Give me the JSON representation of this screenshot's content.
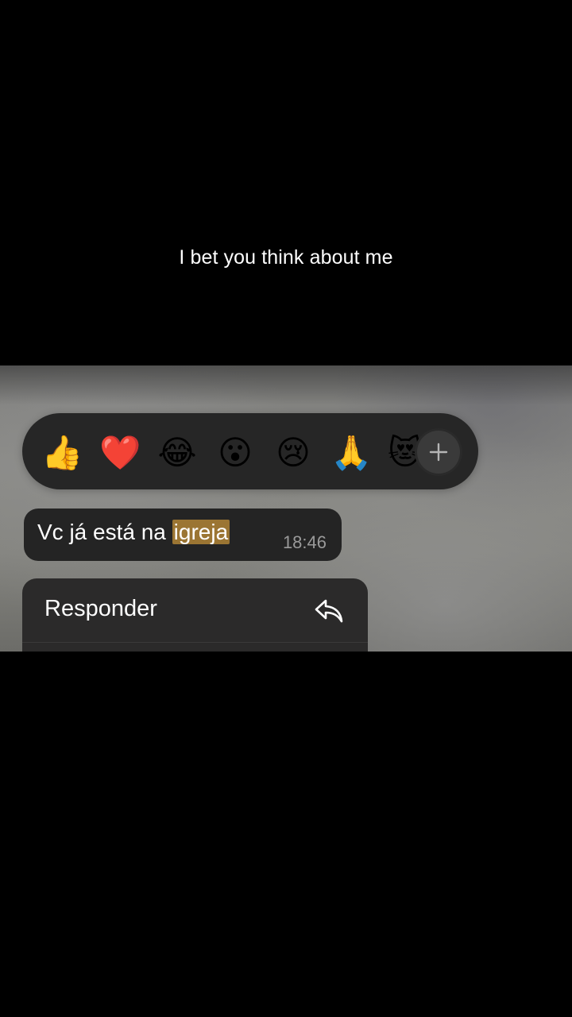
{
  "caption": {
    "text": "I bet you think about me"
  },
  "reactions": {
    "items": [
      {
        "name": "thumbs-up",
        "glyph": "👍"
      },
      {
        "name": "heart",
        "glyph": "❤️"
      },
      {
        "name": "tears-of-joy",
        "glyph": "😂"
      },
      {
        "name": "surprised-face",
        "glyph": "😮"
      },
      {
        "name": "crying-face",
        "glyph": "😢"
      },
      {
        "name": "folded-hands",
        "glyph": "🙏"
      },
      {
        "name": "heart-eyes-cat",
        "glyph": "😻"
      }
    ],
    "more_icon": "plus-icon"
  },
  "message": {
    "text_before": "Vc já está na ",
    "highlighted": "igreja",
    "time": "18:46"
  },
  "context_menu": {
    "items": [
      {
        "label": "Responder",
        "icon": "reply-icon"
      }
    ]
  },
  "colors": {
    "bubble": "#242424",
    "highlight": "#9b7533",
    "reaction_bar": "#262626"
  }
}
